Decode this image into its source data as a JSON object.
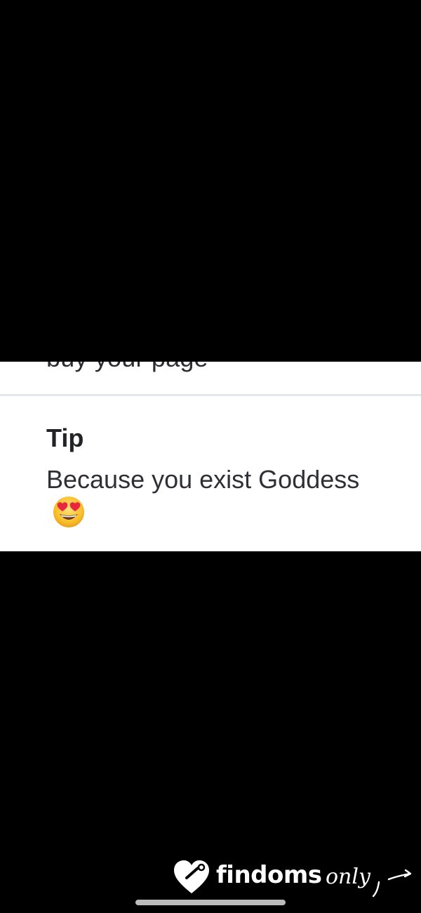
{
  "previous_entry": {
    "message_fragment": "buy your page"
  },
  "tip_card": {
    "title": "Tip",
    "message": "Because you exist Goddess",
    "emoji": "smiling-face-with-heart-eyes"
  },
  "watermark": {
    "brand_bold": "findoms",
    "brand_script": "only",
    "icon": "heart-tag-icon"
  },
  "colors": {
    "background": "#000000",
    "card": "#ffffff",
    "divider": "#e3e6ea",
    "text": "#2e3036"
  }
}
